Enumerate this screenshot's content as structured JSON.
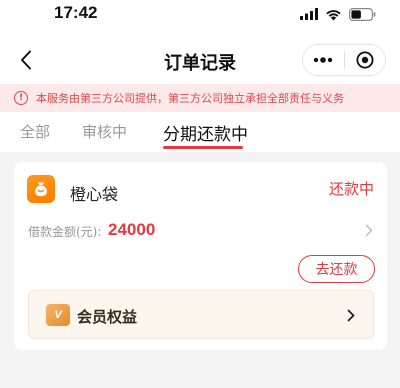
{
  "status_bar": {
    "time": "17:42"
  },
  "nav": {
    "title": "订单记录",
    "back_icon": "chevron-left-icon",
    "more_icon": "more-dots-icon",
    "target_icon": "target-circle-icon"
  },
  "notice": {
    "icon": "alert-circle-icon",
    "icon_glyph": "!",
    "text": "本服务由第三方公司提供，第三方公司独立承担全部责任与义务"
  },
  "tabs": [
    {
      "label": "全部",
      "active": false
    },
    {
      "label": "审核中",
      "active": false
    },
    {
      "label": "分期还款中",
      "active": true
    }
  ],
  "order_card": {
    "brand_icon": "money-bag-icon",
    "brand_name": "橙心袋",
    "status": "还款中",
    "amount_label": "借款金额(元):",
    "amount_value": "24000",
    "repay_button": "去还款",
    "member": {
      "icon": "vip-icon",
      "icon_text": "V",
      "label": "会员权益"
    }
  },
  "colors": {
    "accent_red": "#e8383c",
    "notice_bg": "#fde9e9",
    "brand_orange": "#ff8a0f",
    "member_bg": "#fdf6ef"
  }
}
